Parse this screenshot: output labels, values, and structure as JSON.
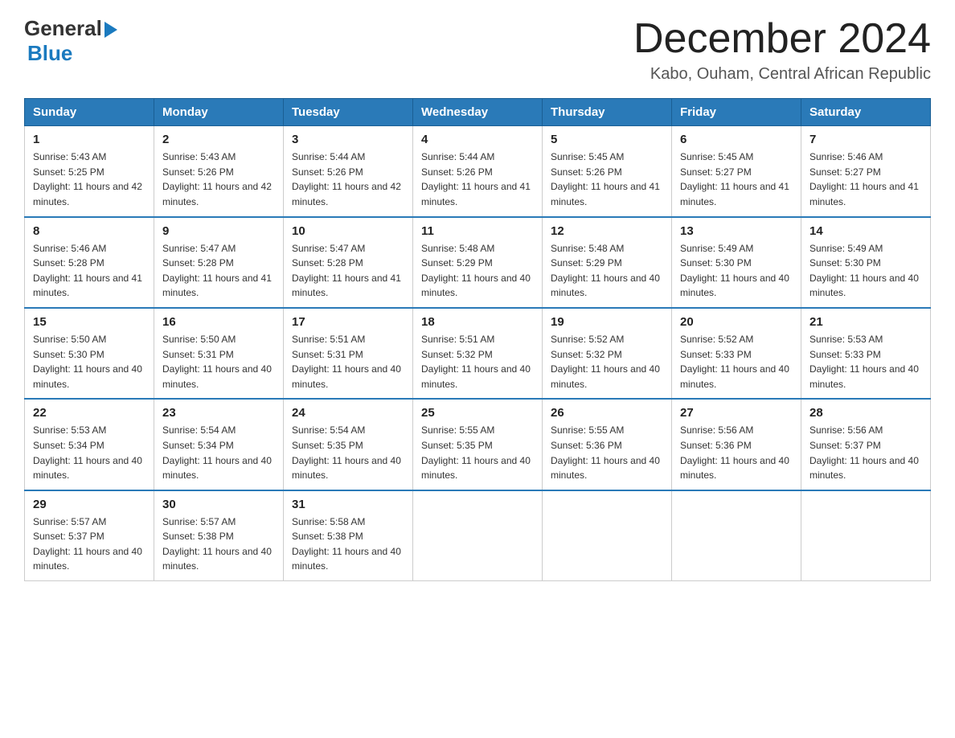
{
  "header": {
    "logo_general": "General",
    "logo_blue": "Blue",
    "month_title": "December 2024",
    "location": "Kabo, Ouham, Central African Republic"
  },
  "weekdays": [
    "Sunday",
    "Monday",
    "Tuesday",
    "Wednesday",
    "Thursday",
    "Friday",
    "Saturday"
  ],
  "weeks": [
    [
      {
        "day": "1",
        "sunrise": "5:43 AM",
        "sunset": "5:25 PM",
        "daylight": "11 hours and 42 minutes."
      },
      {
        "day": "2",
        "sunrise": "5:43 AM",
        "sunset": "5:26 PM",
        "daylight": "11 hours and 42 minutes."
      },
      {
        "day": "3",
        "sunrise": "5:44 AM",
        "sunset": "5:26 PM",
        "daylight": "11 hours and 42 minutes."
      },
      {
        "day": "4",
        "sunrise": "5:44 AM",
        "sunset": "5:26 PM",
        "daylight": "11 hours and 41 minutes."
      },
      {
        "day": "5",
        "sunrise": "5:45 AM",
        "sunset": "5:26 PM",
        "daylight": "11 hours and 41 minutes."
      },
      {
        "day": "6",
        "sunrise": "5:45 AM",
        "sunset": "5:27 PM",
        "daylight": "11 hours and 41 minutes."
      },
      {
        "day": "7",
        "sunrise": "5:46 AM",
        "sunset": "5:27 PM",
        "daylight": "11 hours and 41 minutes."
      }
    ],
    [
      {
        "day": "8",
        "sunrise": "5:46 AM",
        "sunset": "5:28 PM",
        "daylight": "11 hours and 41 minutes."
      },
      {
        "day": "9",
        "sunrise": "5:47 AM",
        "sunset": "5:28 PM",
        "daylight": "11 hours and 41 minutes."
      },
      {
        "day": "10",
        "sunrise": "5:47 AM",
        "sunset": "5:28 PM",
        "daylight": "11 hours and 41 minutes."
      },
      {
        "day": "11",
        "sunrise": "5:48 AM",
        "sunset": "5:29 PM",
        "daylight": "11 hours and 40 minutes."
      },
      {
        "day": "12",
        "sunrise": "5:48 AM",
        "sunset": "5:29 PM",
        "daylight": "11 hours and 40 minutes."
      },
      {
        "day": "13",
        "sunrise": "5:49 AM",
        "sunset": "5:30 PM",
        "daylight": "11 hours and 40 minutes."
      },
      {
        "day": "14",
        "sunrise": "5:49 AM",
        "sunset": "5:30 PM",
        "daylight": "11 hours and 40 minutes."
      }
    ],
    [
      {
        "day": "15",
        "sunrise": "5:50 AM",
        "sunset": "5:30 PM",
        "daylight": "11 hours and 40 minutes."
      },
      {
        "day": "16",
        "sunrise": "5:50 AM",
        "sunset": "5:31 PM",
        "daylight": "11 hours and 40 minutes."
      },
      {
        "day": "17",
        "sunrise": "5:51 AM",
        "sunset": "5:31 PM",
        "daylight": "11 hours and 40 minutes."
      },
      {
        "day": "18",
        "sunrise": "5:51 AM",
        "sunset": "5:32 PM",
        "daylight": "11 hours and 40 minutes."
      },
      {
        "day": "19",
        "sunrise": "5:52 AM",
        "sunset": "5:32 PM",
        "daylight": "11 hours and 40 minutes."
      },
      {
        "day": "20",
        "sunrise": "5:52 AM",
        "sunset": "5:33 PM",
        "daylight": "11 hours and 40 minutes."
      },
      {
        "day": "21",
        "sunrise": "5:53 AM",
        "sunset": "5:33 PM",
        "daylight": "11 hours and 40 minutes."
      }
    ],
    [
      {
        "day": "22",
        "sunrise": "5:53 AM",
        "sunset": "5:34 PM",
        "daylight": "11 hours and 40 minutes."
      },
      {
        "day": "23",
        "sunrise": "5:54 AM",
        "sunset": "5:34 PM",
        "daylight": "11 hours and 40 minutes."
      },
      {
        "day": "24",
        "sunrise": "5:54 AM",
        "sunset": "5:35 PM",
        "daylight": "11 hours and 40 minutes."
      },
      {
        "day": "25",
        "sunrise": "5:55 AM",
        "sunset": "5:35 PM",
        "daylight": "11 hours and 40 minutes."
      },
      {
        "day": "26",
        "sunrise": "5:55 AM",
        "sunset": "5:36 PM",
        "daylight": "11 hours and 40 minutes."
      },
      {
        "day": "27",
        "sunrise": "5:56 AM",
        "sunset": "5:36 PM",
        "daylight": "11 hours and 40 minutes."
      },
      {
        "day": "28",
        "sunrise": "5:56 AM",
        "sunset": "5:37 PM",
        "daylight": "11 hours and 40 minutes."
      }
    ],
    [
      {
        "day": "29",
        "sunrise": "5:57 AM",
        "sunset": "5:37 PM",
        "daylight": "11 hours and 40 minutes."
      },
      {
        "day": "30",
        "sunrise": "5:57 AM",
        "sunset": "5:38 PM",
        "daylight": "11 hours and 40 minutes."
      },
      {
        "day": "31",
        "sunrise": "5:58 AM",
        "sunset": "5:38 PM",
        "daylight": "11 hours and 40 minutes."
      },
      null,
      null,
      null,
      null
    ]
  ]
}
